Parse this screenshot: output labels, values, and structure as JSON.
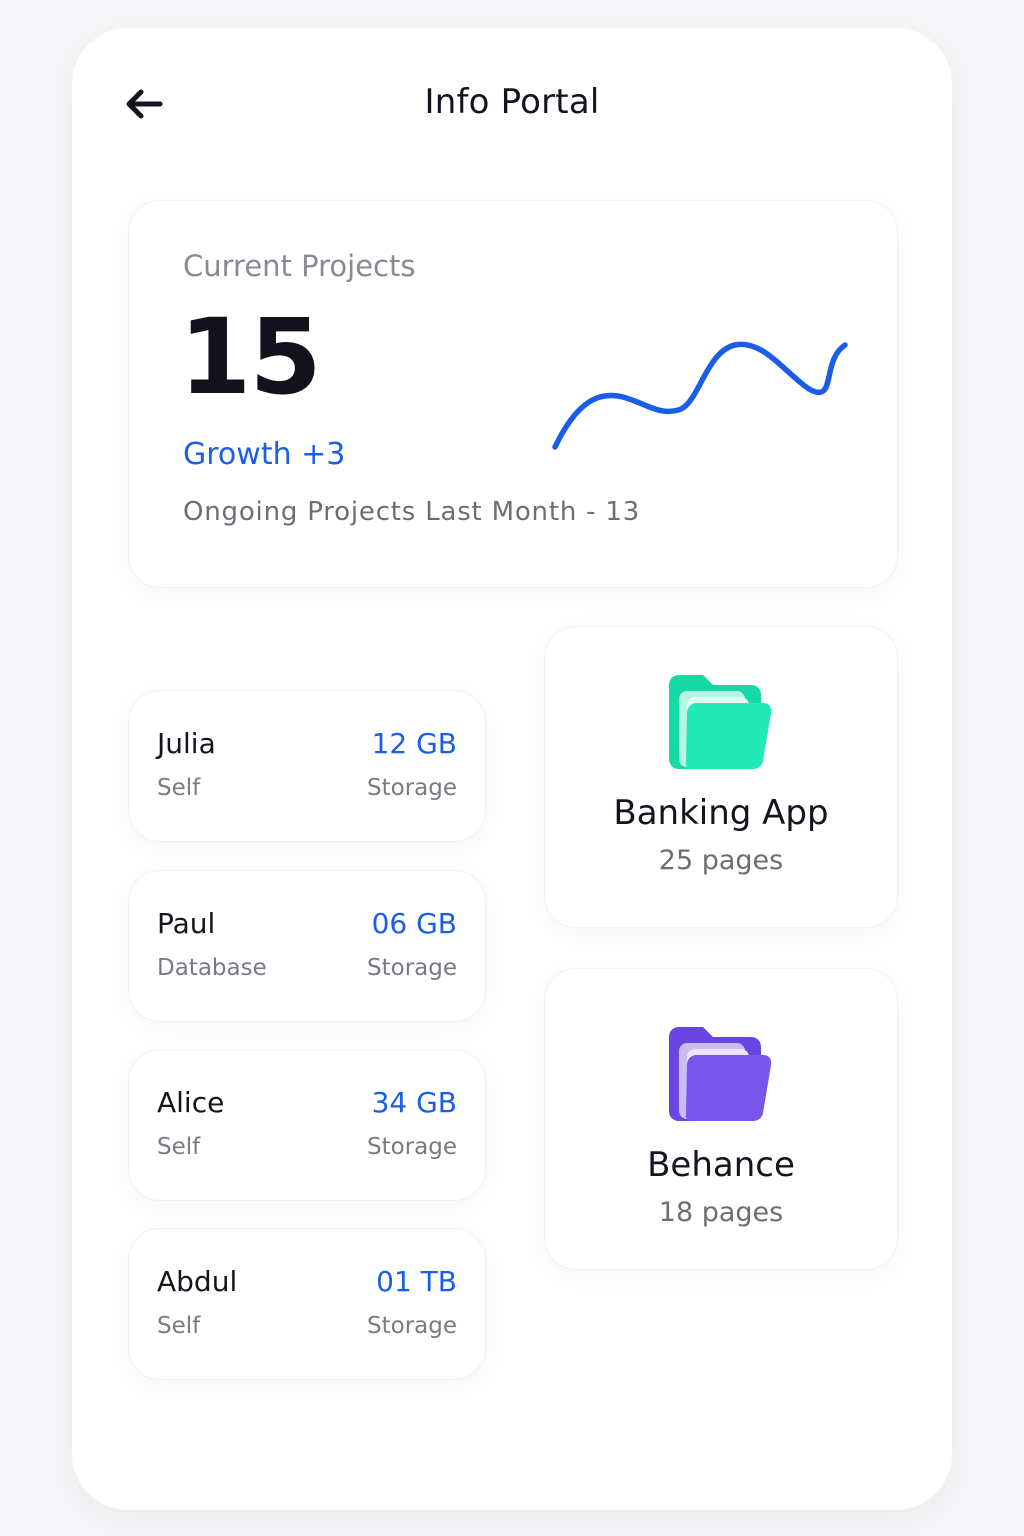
{
  "header": {
    "title": "Info Portal",
    "back_icon": "arrow-left-icon"
  },
  "projects": {
    "label": "Current Projects",
    "count": "15",
    "growth": "Growth +3",
    "last_month": "Ongoing Projects Last Month - 13",
    "trend_color": "#1a5ee8"
  },
  "storage": [
    {
      "name": "Julia",
      "type": "Self",
      "amount": "12 GB",
      "label": "Storage"
    },
    {
      "name": "Paul",
      "type": "Database",
      "amount": "06 GB",
      "label": "Storage"
    },
    {
      "name": "Alice",
      "type": "Self",
      "amount": "34 GB",
      "label": "Storage"
    },
    {
      "name": "Abdul",
      "type": "Self",
      "amount": "01 TB",
      "label": "Storage"
    }
  ],
  "folders": [
    {
      "name": "Banking App",
      "pages": "25 pages",
      "icon": "folder-icon",
      "color": "#22e8b5"
    },
    {
      "name": "Behance",
      "pages": "18 pages",
      "icon": "folder-icon",
      "color": "#7856ec"
    }
  ],
  "colors": {
    "accent": "#1a5ee8",
    "text_primary": "#14141f",
    "text_secondary": "#7a7a84"
  }
}
